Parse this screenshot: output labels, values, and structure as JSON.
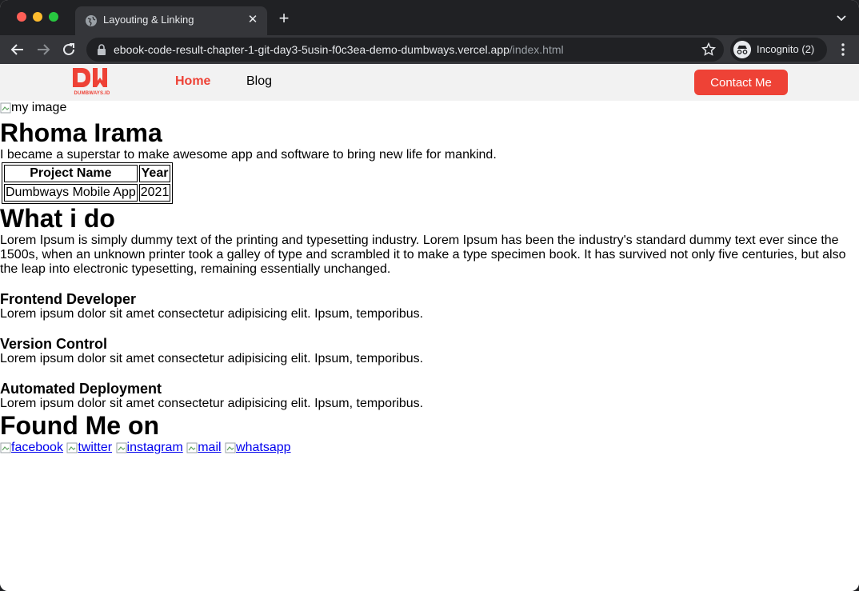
{
  "browser": {
    "tab_title": "Layouting & Linking",
    "url_host": "ebook-code-result-chapter-1-git-day3-5usin-f0c3ea-demo-dumbways.vercel.app",
    "url_path": "/index.html",
    "profile_label": "Incognito (2)"
  },
  "navbar": {
    "logo_text": "DW",
    "logo_subtext": "DUMBWAYS.ID",
    "links": [
      {
        "label": "Home",
        "active": true
      },
      {
        "label": "Blog",
        "active": false
      }
    ],
    "contact_label": "Contact Me",
    "accent_color": "#ee4236"
  },
  "profile": {
    "image_alt": "my image",
    "name": "Rhoma Irama",
    "bio": "I became a superstar to make awesome app and software to bring new life for mankind."
  },
  "projects_table": {
    "headers": [
      "Project Name",
      "Year"
    ],
    "rows": [
      [
        "Dumbways Mobile App",
        "2021"
      ]
    ]
  },
  "what_i_do": {
    "heading": "What i do",
    "intro": "Lorem Ipsum is simply dummy text of the printing and typesetting industry. Lorem Ipsum has been the industry's standard dummy text ever since the 1500s, when an unknown printer took a galley of type and scrambled it to make a type specimen book. It has survived not only five centuries, but also the leap into electronic typesetting, remaining essentially unchanged.",
    "skills": [
      {
        "title": "Frontend Developer",
        "desc": "Lorem ipsum dolor sit amet consectetur adipisicing elit. Ipsum, temporibus."
      },
      {
        "title": "Version Control",
        "desc": "Lorem ipsum dolor sit amet consectetur adipisicing elit. Ipsum, temporibus."
      },
      {
        "title": "Automated Deployment",
        "desc": "Lorem ipsum dolor sit amet consectetur adipisicing elit. Ipsum, temporibus."
      }
    ]
  },
  "found_me": {
    "heading": "Found Me on",
    "links": [
      "facebook",
      "twitter",
      "instagram",
      "mail",
      "whatsapp"
    ]
  }
}
